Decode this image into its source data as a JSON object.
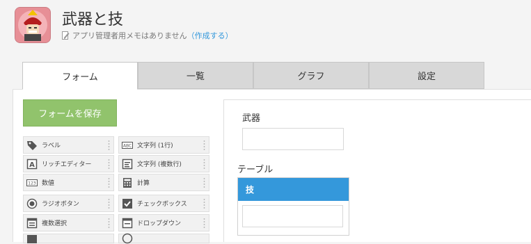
{
  "app": {
    "title": "武器と技",
    "memo_text": "アプリ管理者用メモはありません",
    "memo_link": "（作成する）"
  },
  "tabs": [
    {
      "label": "フォーム",
      "active": true
    },
    {
      "label": "一覧",
      "active": false
    },
    {
      "label": "グラフ",
      "active": false
    },
    {
      "label": "設定",
      "active": false
    }
  ],
  "toolbar": {
    "save_label": "フォームを保存"
  },
  "palette": [
    {
      "label": "ラベル",
      "icon": "tag-icon"
    },
    {
      "label": "文字列 (1行)",
      "icon": "abc-icon"
    },
    {
      "label": "リッチエディター",
      "icon": "rich-text-icon"
    },
    {
      "label": "文字列 (複数行)",
      "icon": "multiline-text-icon"
    },
    {
      "label": "数値",
      "icon": "number-icon"
    },
    {
      "label": "計算",
      "icon": "calculator-icon"
    },
    {
      "label": "ラジオボタン",
      "icon": "radio-icon"
    },
    {
      "label": "チェックボックス",
      "icon": "checkbox-icon"
    },
    {
      "label": "複数選択",
      "icon": "multi-select-icon"
    },
    {
      "label": "ドロップダウン",
      "icon": "dropdown-icon"
    }
  ],
  "form": {
    "field_label": "武器",
    "field_value": "",
    "table_label": "テーブル",
    "table_column": "技",
    "table_cell_value": ""
  },
  "colors": {
    "save_button": "#91c36c",
    "table_header": "#3498db",
    "link": "#3498db",
    "app_icon_bg": "#e78f96"
  }
}
